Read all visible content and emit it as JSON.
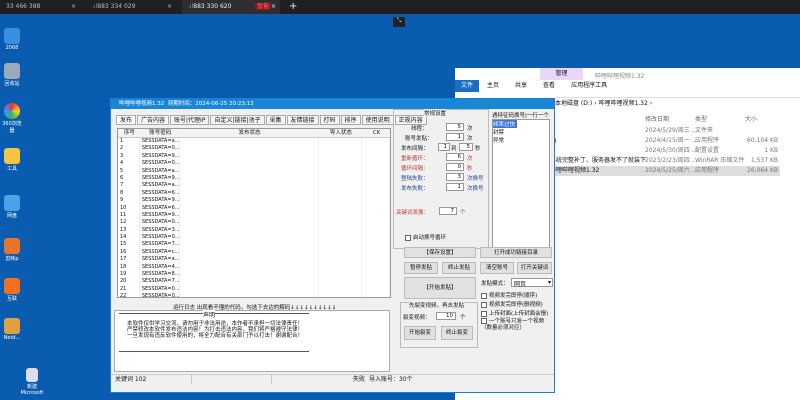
{
  "topbar": {
    "tabs": [
      {
        "label": "33 466 388"
      },
      {
        "label": "883 334 029"
      },
      {
        "label": "883 330 620",
        "badge": "智能"
      }
    ],
    "new_tab": "+",
    "close": "×"
  },
  "desktop": {
    "icons": [
      {
        "label": "2068"
      },
      {
        "label": "回收站"
      },
      {
        "label": "360浏览器"
      },
      {
        "label": "工具"
      },
      {
        "label": "网盘"
      },
      {
        "label": "剪映p"
      },
      {
        "label": "互联"
      },
      {
        "label": "Netd..."
      }
    ],
    "file": {
      "label": "新建 Microsoft"
    }
  },
  "explorer": {
    "ribbon_tab": "管理",
    "title": "哔哩哔哩视频1.32",
    "menus": [
      "文件",
      "主页",
      "共享",
      "查看",
      "应用程序工具"
    ],
    "path": [
      "本地磁盘 (D:)",
      "哔哩哔哩视频1.32"
    ],
    "columns": [
      "修改日期",
      "类型",
      "大小"
    ],
    "files": [
      {
        "name": "",
        "date": "2024/5/29/周三 ...",
        "type": "文件夹",
        "size": ""
      },
      {
        "name": "rg",
        "date": "2024/4/15/周一 ...",
        "type": "应用程序",
        "size": "60,104 KB"
      },
      {
        "name": "",
        "date": "2024/5/30/周四 ...",
        "type": "配置设置",
        "size": "1 KB"
      },
      {
        "name": "系统完整补丁、服务器发不了就装下",
        "date": "2023/2/23/周四 ...",
        "type": "WinRAR 压缩文件",
        "size": "1,537 KB"
      },
      {
        "name": "哔哩哔哩视频1.32",
        "date": "2024/5/25/周六 ...",
        "type": "应用程序",
        "size": "26,064 KB"
      }
    ]
  },
  "app": {
    "title": "哔哩哔哩视频1.32",
    "expire": "到期时间：2024-06-25 20:23:13",
    "tabs": [
      "发布",
      "广告内容",
      "账号|代理IP",
      "自定义|链接|池子",
      "采集",
      "友情链接",
      "打码",
      "排序",
      "使用说明",
      "正规内容"
    ],
    "table": {
      "columns": [
        "序号",
        "账号密码",
        "发布状态",
        "导入状态",
        "CK"
      ],
      "rows": [
        [
          "1",
          "SESSDATA=a..."
        ],
        [
          "2",
          "SESSDATA=0..."
        ],
        [
          "3",
          "SESSDATA=9..."
        ],
        [
          "4",
          "SESSDATA=0..."
        ],
        [
          "5",
          "SESSDATA=a..."
        ],
        [
          "6",
          "SESSDATA=9..."
        ],
        [
          "7",
          "SESSDATA=a..."
        ],
        [
          "8",
          "SESSDATA=6..."
        ],
        [
          "9",
          "SESSDATA=9..."
        ],
        [
          "10",
          "SESSDATA=6..."
        ],
        [
          "11",
          "SESSDATA=9..."
        ],
        [
          "12",
          "SESSDATA=0..."
        ],
        [
          "13",
          "SESSDATA=3..."
        ],
        [
          "14",
          "SESSDATA=0..."
        ],
        [
          "15",
          "SESSDATA=7..."
        ],
        [
          "16",
          "SESSDATA=c..."
        ],
        [
          "17",
          "SESSDATA=a..."
        ],
        [
          "18",
          "SESSDATA=4..."
        ],
        [
          "19",
          "SESSDATA=8..."
        ],
        [
          "20",
          "SESSDATA=7..."
        ],
        [
          "21",
          "SESSDATA=0..."
        ],
        [
          "22",
          "SESSDATA=0..."
        ]
      ]
    },
    "settings": {
      "title": "常规设置",
      "threads": {
        "label": "线程：",
        "value": "5",
        "unit": "次"
      },
      "per_account": {
        "label": "账号发贴：",
        "value": "1",
        "unit": "次"
      },
      "interval": {
        "label": "发布间隔：",
        "from": "1",
        "to_label": "到",
        "to": "5",
        "unit": "秒"
      },
      "loop": {
        "label": "重新循环：",
        "value": "6",
        "unit": "次"
      },
      "loop_interval": {
        "label": "循环间隔：",
        "value": "0",
        "unit": "秒"
      },
      "login_fail": {
        "label": "登陆失败：",
        "value": "3",
        "unit": "次换号"
      },
      "post_fail": {
        "label": "发布失败：",
        "value": "1",
        "unit": "次换号"
      },
      "keyword": {
        "label": "关键词发展：",
        "value": "7",
        "unit": "个"
      },
      "auto_loop": "启动换号循环"
    },
    "verify": {
      "title": "遇特征码换号|一行一个",
      "items": [
        "频率过快",
        "封禁",
        "异常"
      ]
    },
    "buttons": {
      "save": "【保存设置】",
      "open_dir": "打开成功链接目录",
      "pause": "暂停发贴",
      "stop": "终止发贴",
      "clear": "清空账号",
      "open_kw": "打开关键词",
      "start": "【开始发贴】",
      "start_split": "开始裂变",
      "stop_split": "终止裂变"
    },
    "split": {
      "title": "先裂变视频，再去发贴",
      "label": "裂变视频：",
      "value": "10",
      "unit": "个"
    },
    "mode": {
      "label": "发贴模式：",
      "value": "网页"
    },
    "options": [
      "视频发完即停(顺序)",
      "视频发完即停(删视频)",
      "上传封面(上传封面会慢)",
      "一个账号只发一个视频（数量必须对应）"
    ],
    "log": {
      "header": "运行日志 出现看不懂的代码，勾选下去边的解码↓↓↓↓↓↓↓↓↓↓",
      "notice_title": "声明",
      "lines": [
        "本软件仅供学习交流，请勿用于非法用途，本作者不承担一切法律责任！",
        "严禁修改本软件发布违法内容！为打击违法内容，我们将严格遵守法律！",
        "一旦发现有违反软件使用的，将全力配合有关部门予以打击！谢谢配合！"
      ]
    },
    "status": {
      "keywords": "关键词 102",
      "right1": "失败",
      "right2": "导入账号：30个"
    }
  }
}
